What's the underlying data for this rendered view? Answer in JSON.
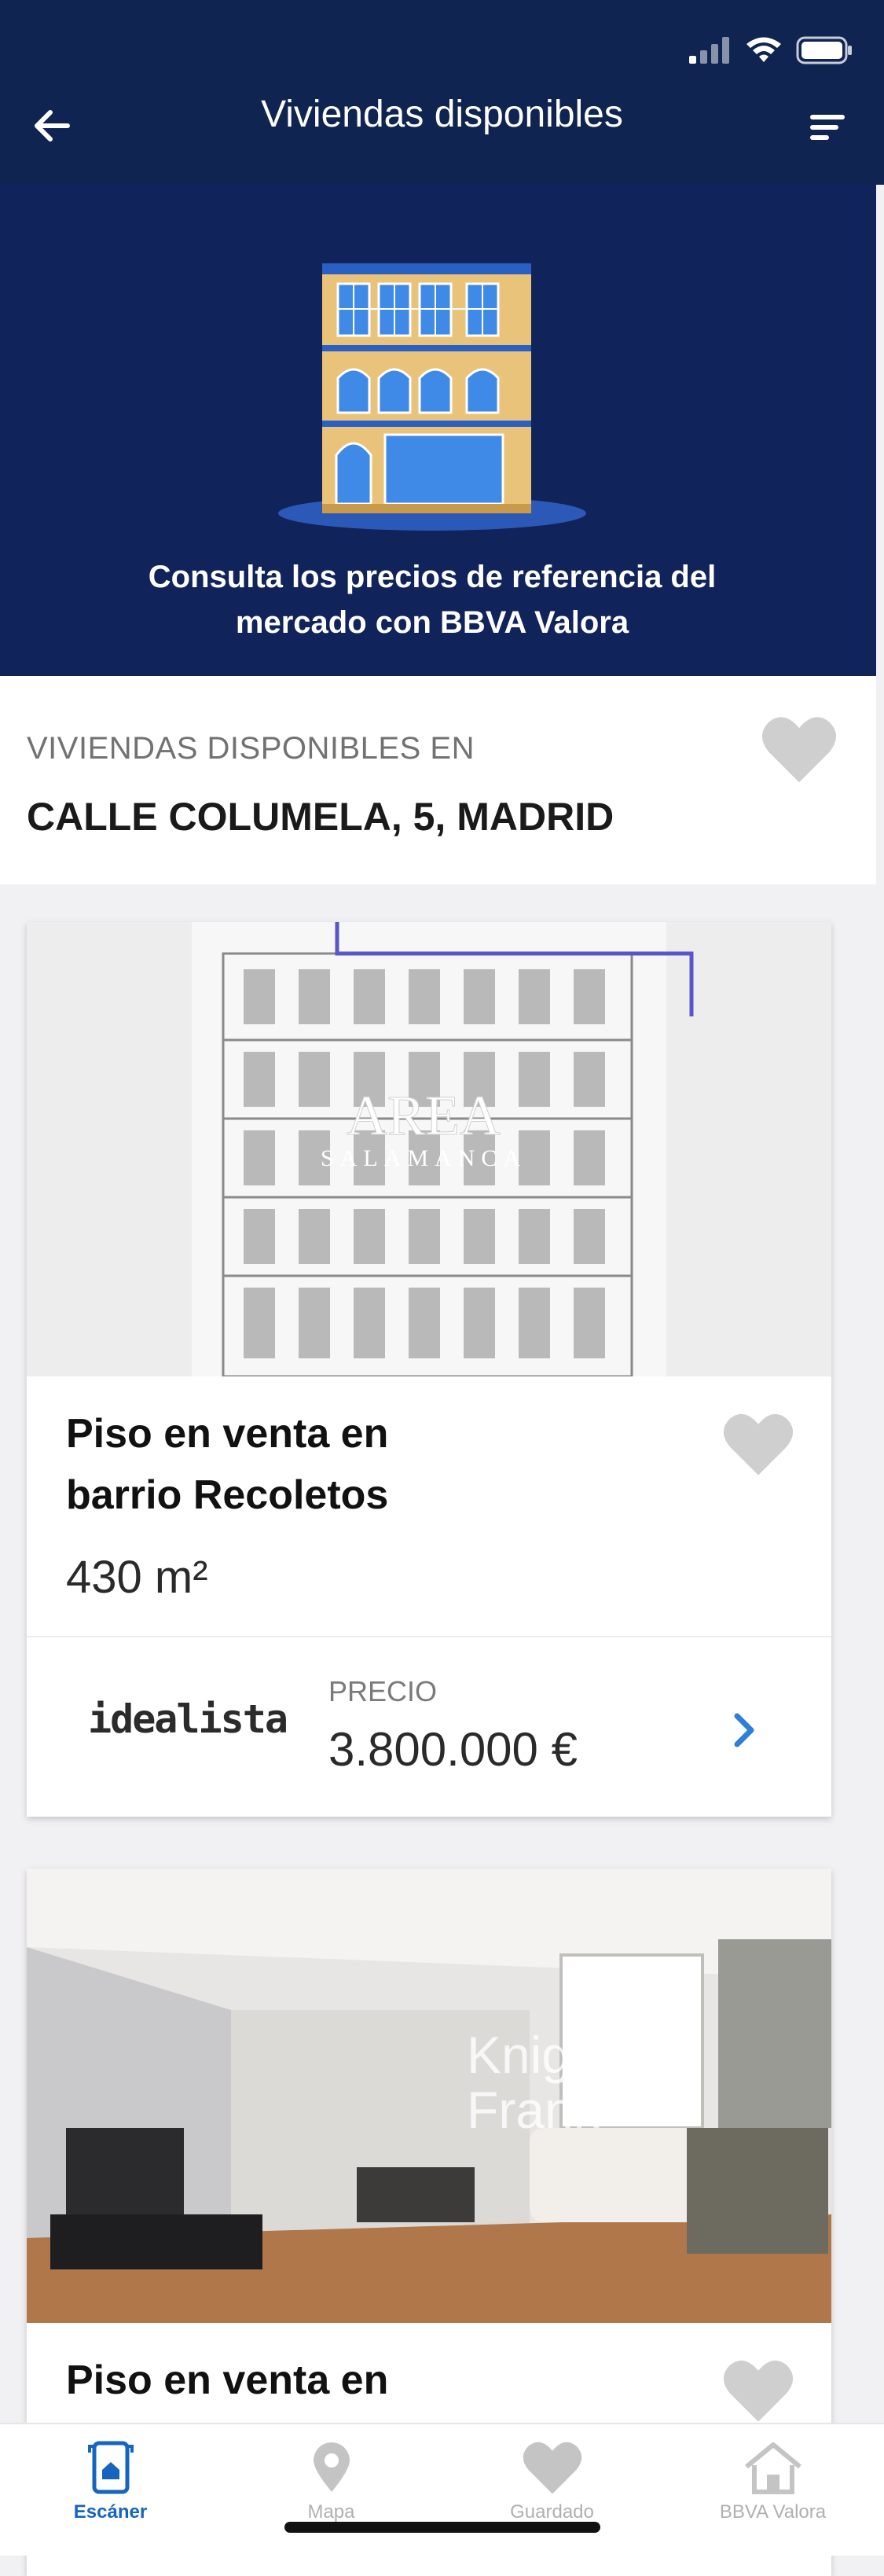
{
  "header": {
    "title": "Viviendas disponibles"
  },
  "hero": {
    "text_line1": "Consulta los precios de referencia del",
    "text_line2": "mercado con BBVA Valora"
  },
  "location": {
    "label": "VIVIENDAS DISPONIBLES EN",
    "address": "CALLE COLUMELA, 5, MADRID"
  },
  "listings": [
    {
      "title_line1": "Piso en venta en",
      "title_line2": "barrio Recoletos",
      "area": "430 m²",
      "portal": "idealista",
      "price_label": "PRECIO",
      "price": "3.800.000 €",
      "photo_watermark": "AREA",
      "photo_watermark_sub": "SALAMANCA"
    },
    {
      "title_line1": "Piso en venta en",
      "photo_watermark": "Knight",
      "photo_watermark_sub": "Frank"
    }
  ],
  "tabs": [
    {
      "label": "Escáner",
      "icon": "phone-scan-icon",
      "active": true
    },
    {
      "label": "Mapa",
      "icon": "map-pin-icon",
      "active": false
    },
    {
      "label": "Guardado",
      "icon": "heart-icon",
      "active": false
    },
    {
      "label": "BBVA Valora",
      "icon": "house-icon",
      "active": false
    }
  ],
  "colors": {
    "navy": "#0f2450",
    "accent_blue": "#1565c0",
    "chevron_blue": "#2f7fd6",
    "heart_gray": "#c8c8c8"
  }
}
